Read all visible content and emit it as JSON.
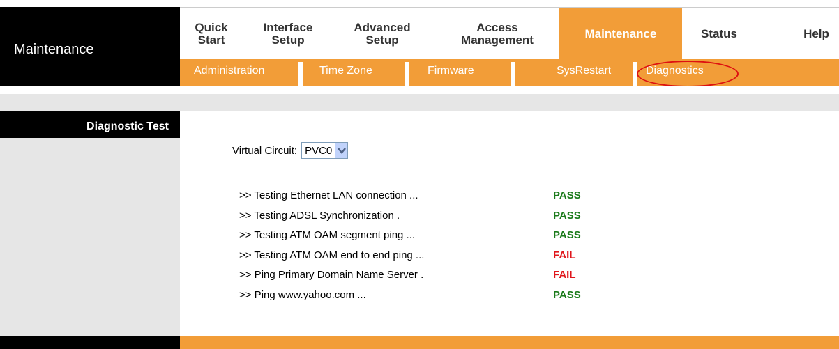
{
  "section": {
    "title": "Maintenance"
  },
  "nav": {
    "items": [
      {
        "label_line1": "Quick",
        "label_line2": "Start"
      },
      {
        "label_line1": "Interface",
        "label_line2": "Setup"
      },
      {
        "label_line1": "Advanced",
        "label_line2": "Setup"
      },
      {
        "label_line1": "Access",
        "label_line2": "Management"
      },
      {
        "label_line1": "Maintenance",
        "label_line2": ""
      },
      {
        "label_line1": "Status",
        "label_line2": ""
      },
      {
        "label_line1": "Help",
        "label_line2": ""
      }
    ],
    "active": "Maintenance"
  },
  "subnav": {
    "items": [
      "Administration",
      "Time Zone",
      "Firmware",
      "SysRestart",
      "Diagnostics"
    ],
    "active": "Diagnostics"
  },
  "left": {
    "header": "Diagnostic Test"
  },
  "virtual_circuit": {
    "label": "Virtual Circuit:",
    "value": "PVC0"
  },
  "tests": [
    {
      "label": ">> Testing Ethernet LAN connection ...",
      "result": "PASS"
    },
    {
      "label": ">> Testing ADSL Synchronization .",
      "result": "PASS"
    },
    {
      "label": ">> Testing ATM OAM segment ping ...",
      "result": "PASS"
    },
    {
      "label": ">> Testing ATM OAM end to end ping ...",
      "result": "FAIL"
    },
    {
      "label": ">> Ping Primary Domain Name Server .",
      "result": "FAIL"
    },
    {
      "label": ">> Ping www.yahoo.com ...",
      "result": "PASS"
    }
  ],
  "colors": {
    "accent": "#f29d38",
    "pass": "#1a7a1a",
    "fail": "#e0161b",
    "highlight": "#dd1111"
  }
}
